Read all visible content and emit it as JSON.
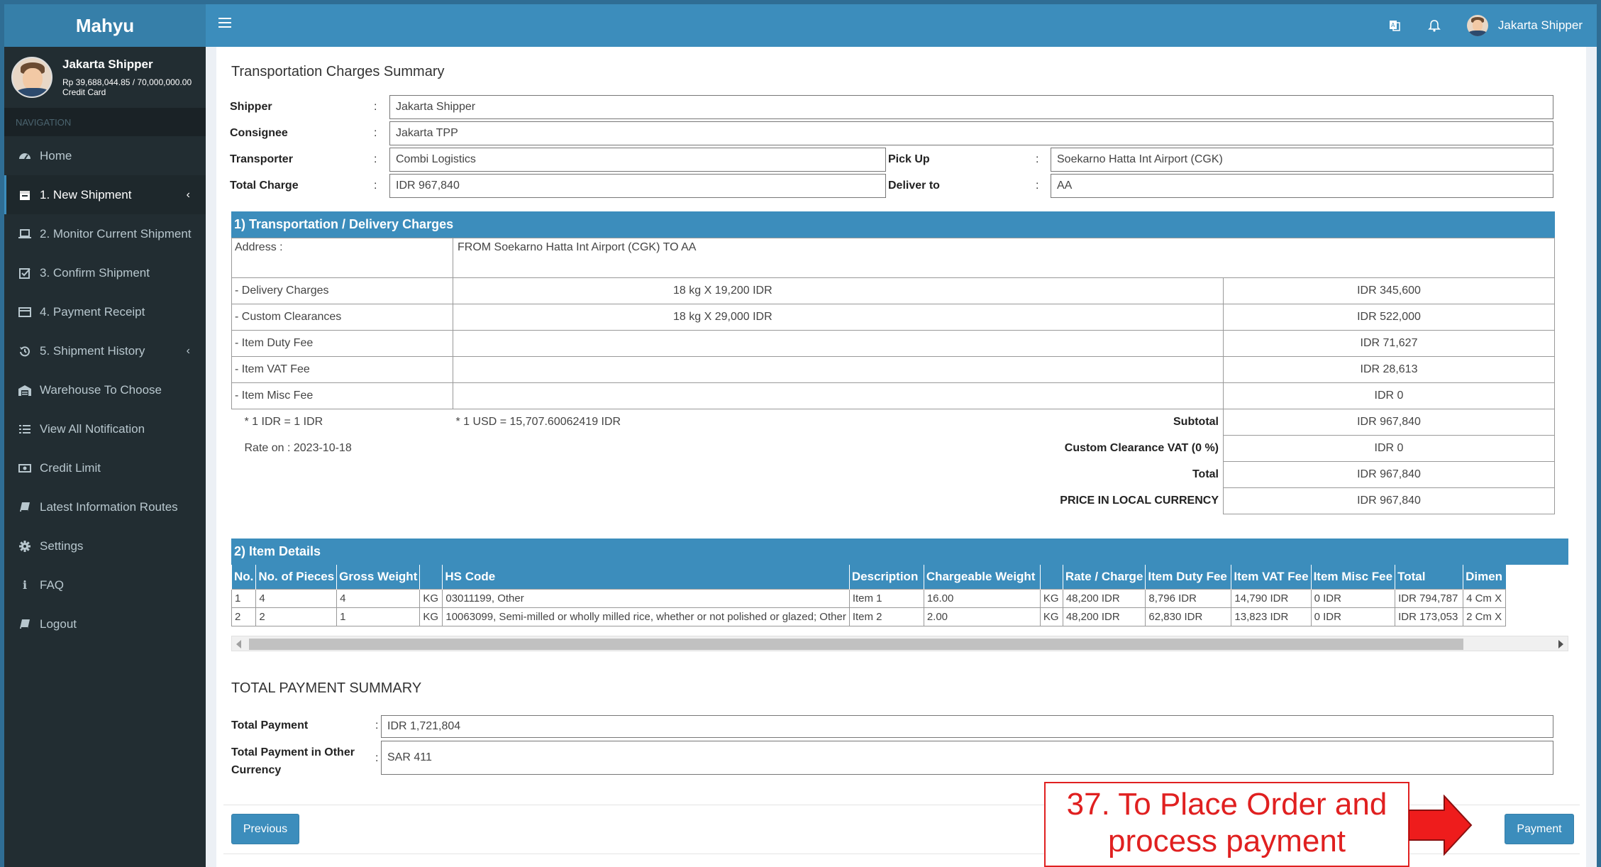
{
  "app": {
    "brand": "Mahyu"
  },
  "user": {
    "name": "Jakarta Shipper",
    "credit": "Rp 39,688,044.85 / 70,000,000.00",
    "payment_type": "Credit Card"
  },
  "sidebar": {
    "nav_header": "NAVIGATION",
    "items": [
      {
        "label": "Home",
        "icon": "dashboard-icon"
      },
      {
        "label": "1. New Shipment",
        "icon": "calendar-icon"
      },
      {
        "label": "2. Monitor Current Shipment",
        "icon": "laptop-icon"
      },
      {
        "label": "3. Confirm Shipment",
        "icon": "checkbox-icon"
      },
      {
        "label": "4. Payment Receipt",
        "icon": "credit-card-icon"
      },
      {
        "label": "5. Shipment History",
        "icon": "history-icon"
      },
      {
        "label": "Warehouse To Choose",
        "icon": "warehouse-icon"
      },
      {
        "label": "View All Notification",
        "icon": "list-icon"
      },
      {
        "label": "Credit Limit",
        "icon": "money-icon"
      },
      {
        "label": "Latest Information Routes",
        "icon": "book-icon"
      },
      {
        "label": "Settings",
        "icon": "gear-icon"
      },
      {
        "label": "FAQ",
        "icon": "info-icon"
      },
      {
        "label": "Logout",
        "icon": "book-icon"
      }
    ]
  },
  "topbar": {
    "user_name": "Jakarta Shipper"
  },
  "page": {
    "title": "Transportation Charges Summary",
    "fields": {
      "shipper_label": "Shipper",
      "shipper": "Jakarta Shipper",
      "consignee_label": "Consignee",
      "consignee": "Jakarta TPP",
      "transporter_label": "Transporter",
      "transporter": "Combi Logistics",
      "total_charge_label": "Total Charge",
      "total_charge": "IDR 967,840",
      "pickup_label": "Pick Up",
      "pickup": "Soekarno Hatta Int Airport (CGK)",
      "deliver_label": "Deliver to",
      "deliver": "AA",
      "colon": ":"
    },
    "charges": {
      "heading": "1) Transportation / Delivery Charges",
      "address_label": "Address :",
      "address": "FROM Soekarno Hatta Int Airport (CGK) TO AA",
      "rows": [
        {
          "label": "- Delivery Charges",
          "detail": "18 kg X 19,200 IDR",
          "amount": "IDR 345,600"
        },
        {
          "label": "- Custom Clearances",
          "detail": "18 kg X 29,000 IDR",
          "amount": "IDR 522,000"
        },
        {
          "label": "- Item Duty Fee",
          "detail": "",
          "amount": "IDR 71,627"
        },
        {
          "label": "- Item VAT Fee",
          "detail": "",
          "amount": "IDR 28,613"
        },
        {
          "label": "- Item Misc Fee",
          "detail": "",
          "amount": "IDR 0"
        }
      ],
      "rate_idr": "* 1 IDR = 1 IDR",
      "rate_usd": "* 1 USD = 15,707.60062419 IDR",
      "rate_on": "Rate on : 2023-10-18",
      "subtotal_label": "Subtotal",
      "subtotal": "IDR 967,840",
      "vat_label": "Custom Clearance VAT (0 %)",
      "vat": "IDR 0",
      "total_label": "Total",
      "total": "IDR 967,840",
      "local_label": "PRICE IN LOCAL CURRENCY",
      "local": "IDR 967,840"
    },
    "items": {
      "heading": "2) Item Details",
      "columns": [
        "No.",
        "No. of Pieces",
        "Gross Weight",
        "",
        "HS Code",
        "Description",
        "Chargeable Weight",
        "",
        "Rate / Charge",
        "Item Duty Fee",
        "Item VAT Fee",
        "Item Misc Fee",
        "Total",
        "Dimen"
      ],
      "rows": [
        [
          "1",
          "4",
          "4",
          "KG",
          "03011199, Other",
          "Item 1",
          "16.00",
          "KG",
          "48,200 IDR",
          "8,796 IDR",
          "14,790 IDR",
          "0 IDR",
          "IDR 794,787",
          "4 Cm X"
        ],
        [
          "2",
          "2",
          "1",
          "KG",
          "10063099, Semi-milled or wholly milled rice, whether or not polished or glazed; Other",
          "Item 2",
          "2.00",
          "KG",
          "48,200 IDR",
          "62,830 IDR",
          "13,823 IDR",
          "0 IDR",
          "IDR 173,053",
          "2 Cm X"
        ]
      ]
    },
    "summary": {
      "title": "TOTAL PAYMENT SUMMARY",
      "total_label": "Total Payment",
      "total": "IDR 1,721,804",
      "other_label_1": "Total Payment in Other",
      "other_label_2": "Currency",
      "other": "SAR 411"
    },
    "buttons": {
      "previous": "Previous",
      "payment": "Payment"
    },
    "annotation": {
      "line1": "37. To Place Order and",
      "line2": "process payment"
    }
  }
}
